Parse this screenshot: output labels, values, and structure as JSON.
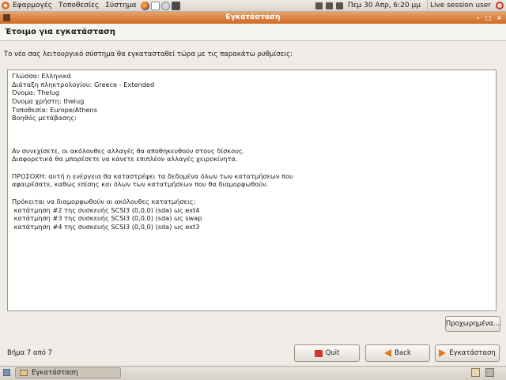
{
  "top_panel": {
    "menus": [
      "Εφαρμογές",
      "Τοποθεσίες",
      "Σύστημα"
    ],
    "clock": "Πεμ 30 Απρ,  6:20 μμ",
    "session_user": "Live session user"
  },
  "window": {
    "title": "Εγκατάσταση"
  },
  "page": {
    "heading": "Έτοιμο για εγκατάσταση",
    "intro": "Το νέο σας λειτουργικό σύστημα θα εγκατασταθεί τώρα με τις παρακάτω ρυθμίσεις:"
  },
  "summary_lines": [
    "Γλώσσα: Ελληνικά",
    "Διάταξη πληκτρολογίου: Greece - Extended",
    "Όνομα: Thelug",
    "Όνομα χρήστη: thelug",
    "Τοποθεσία: Europe/Athens",
    "Βοηθός μετάβασης:",
    "Αν συνεχίσετε, οι ακόλουθες αλλαγές θα αποθηκευθούν στους δίσκους.",
    "Διαφορετικά θα μπορέσετε να κάνετε επιπλέον αλλαγές χειροκίνητα.",
    "ΠΡΟΣΟΧΗ: αυτή η ενέργεια θα καταστρέψει τα δεδομένα όλων των κατατμήσεων που",
    "αφαιρέσατε, καθώς επίσης και όλων των κατατμήσεων που θα διαμορφωθούν.",
    "Πρόκειται να διαμορφωθούν οι ακόλουθες κατατμήσεις:",
    " κατάτμηση #2 της συσκευής SCSI3 (0,0,0) (sda) ως ext4",
    " κατάτμηση #3 της συσκευής SCSI3 (0,0,0) (sda) ως swap",
    " κατάτμηση #4 της συσκευής SCSI3 (0,0,0) (sda) ως ext3"
  ],
  "buttons": {
    "advanced": "Προχωρημένα...",
    "quit": "Quit",
    "back": "Back",
    "install": "Εγκατάσταση"
  },
  "step": "Βήμα 7 από 7",
  "taskbar": {
    "task_label": "Εγκατάσταση"
  },
  "colors": {
    "title_bar": "#d47a36",
    "panel": "#e6e2dc",
    "background": "#efebe7"
  }
}
